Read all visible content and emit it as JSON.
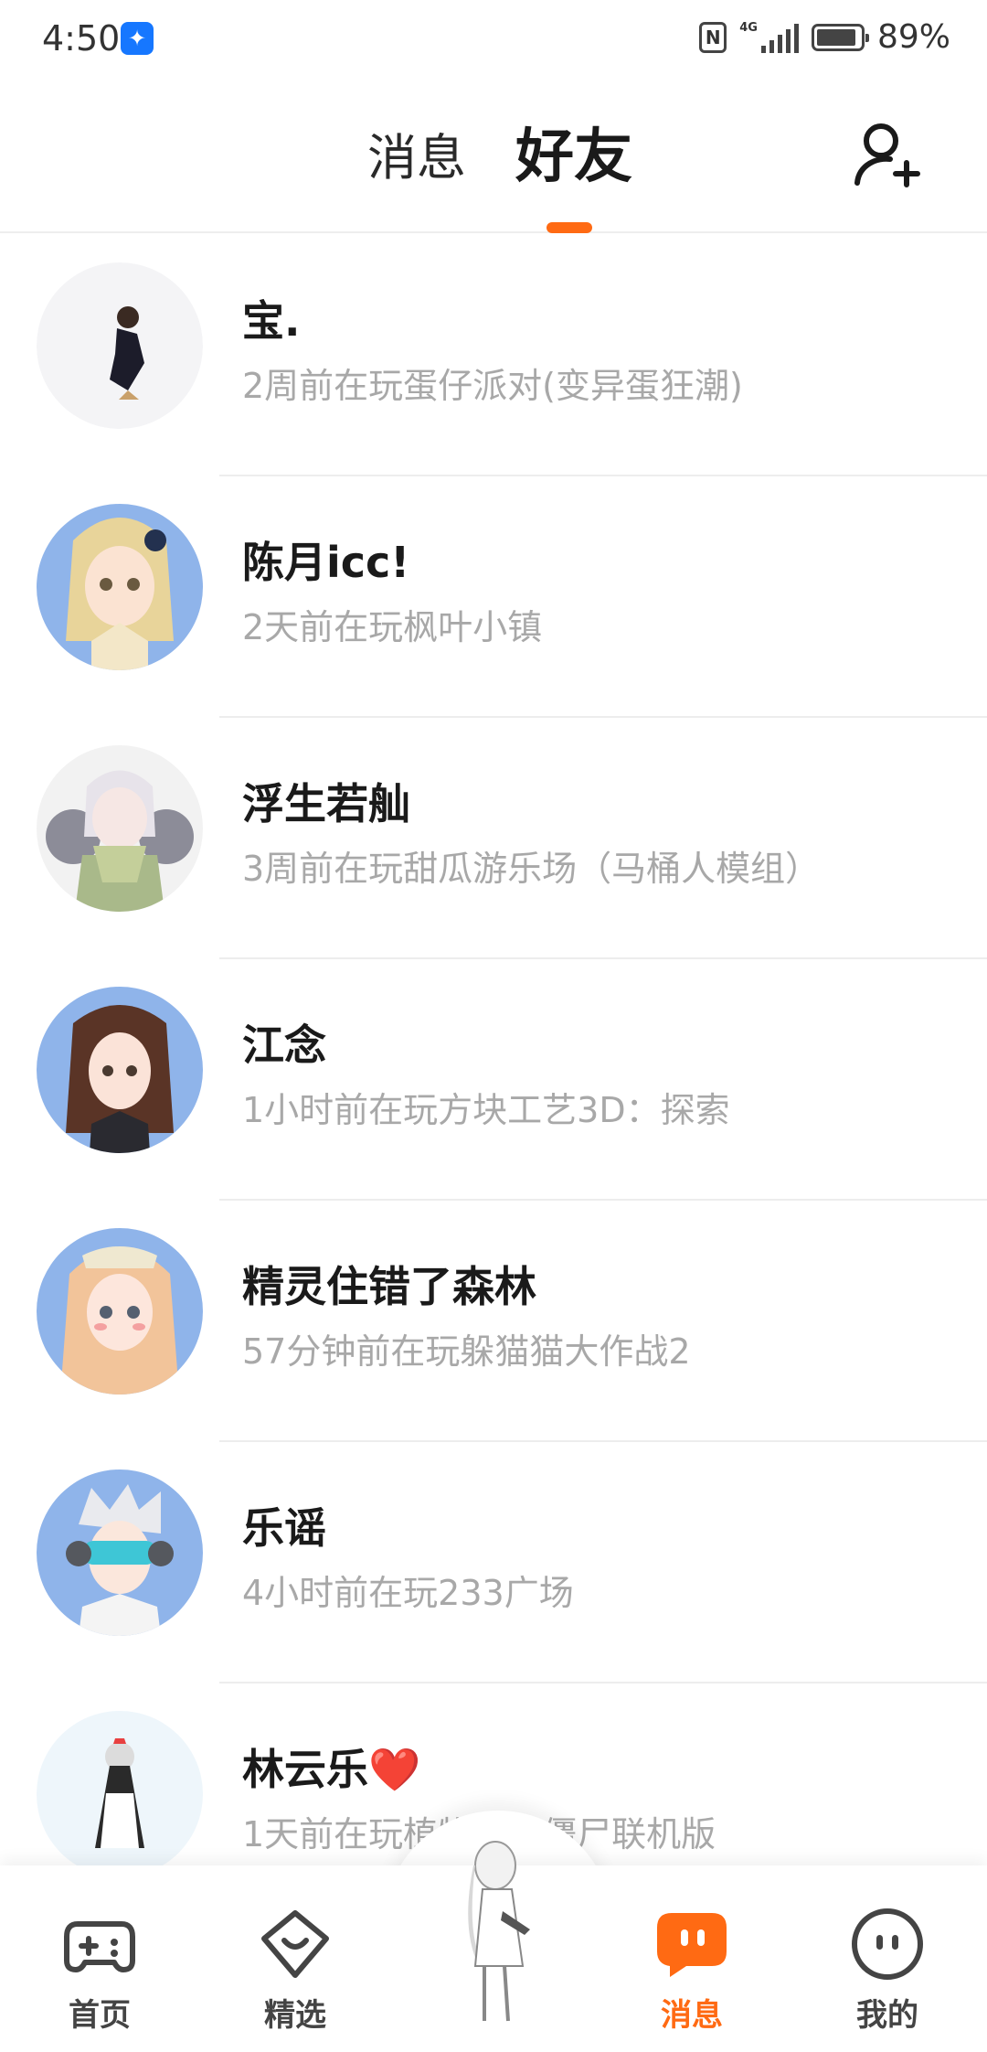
{
  "status_bar": {
    "time": "4:50",
    "battery": "89%",
    "network": "4G"
  },
  "header": {
    "tabs": [
      {
        "label": "消息",
        "active": false
      },
      {
        "label": "好友",
        "active": true
      }
    ],
    "add_friend_icon": "add-user-icon",
    "accent": "#ff6a13"
  },
  "friends": [
    {
      "name": "宝.",
      "status": "2周前在玩蛋仔派对(变异蛋狂潮)"
    },
    {
      "name": "陈月icc!",
      "status": "2天前在玩枫叶小镇"
    },
    {
      "name": "浮生若舢",
      "status": "3周前在玩甜瓜游乐场（马桶人模组）"
    },
    {
      "name": "江念",
      "status": "1小时前在玩方块工艺3D：探索"
    },
    {
      "name": "精灵住错了森林",
      "status": "57分钟前在玩躲猫猫大作战2"
    },
    {
      "name": "乐谣",
      "status": "4小时前在玩233广场"
    },
    {
      "name": "林云乐",
      "name_suffix": "❤️",
      "status": "1天前在玩植物大战僵尸联机版"
    }
  ],
  "bottom_nav": {
    "items": [
      {
        "label": "首页",
        "icon": "gamepad-icon",
        "active": false
      },
      {
        "label": "精选",
        "icon": "heart-badge-icon",
        "active": false
      },
      {
        "label": "消息",
        "icon": "message-icon",
        "active": true
      },
      {
        "label": "我的",
        "icon": "face-icon",
        "active": false
      }
    ],
    "center_icon": "avatar-figure-icon"
  }
}
